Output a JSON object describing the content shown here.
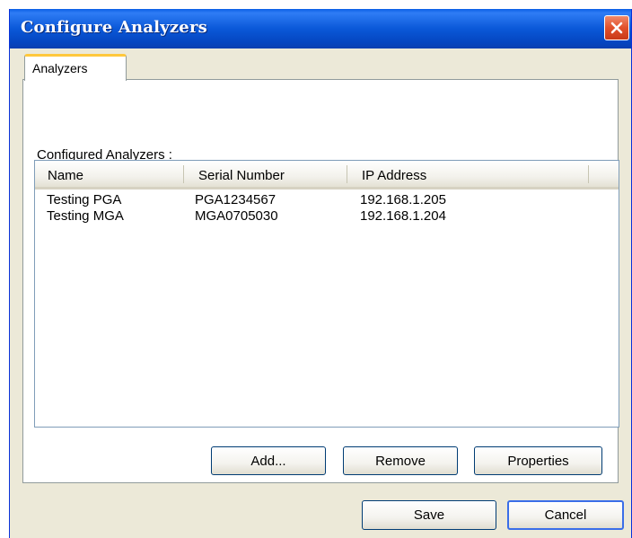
{
  "window": {
    "title": "Configure Analyzers"
  },
  "tabs": [
    {
      "label": "Analyzers",
      "active": true
    }
  ],
  "section": {
    "label": "Configured Analyzers :"
  },
  "list": {
    "columns": [
      "Name",
      "Serial Number",
      "IP Address"
    ],
    "rows": [
      {
        "name": "Testing PGA",
        "serial": "PGA1234567",
        "ip": "192.168.1.205"
      },
      {
        "name": "Testing MGA",
        "serial": "MGA0705030",
        "ip": "192.168.1.204"
      }
    ]
  },
  "buttons": {
    "add": "Add...",
    "remove": "Remove",
    "properties": "Properties",
    "save": "Save",
    "cancel": "Cancel"
  },
  "icons": {
    "close": "close-icon"
  },
  "colors": {
    "titlebar": "#0a58d8",
    "close": "#e2502a",
    "tab_accent": "#ffc83c",
    "dialog_bg": "#ece9d8"
  }
}
